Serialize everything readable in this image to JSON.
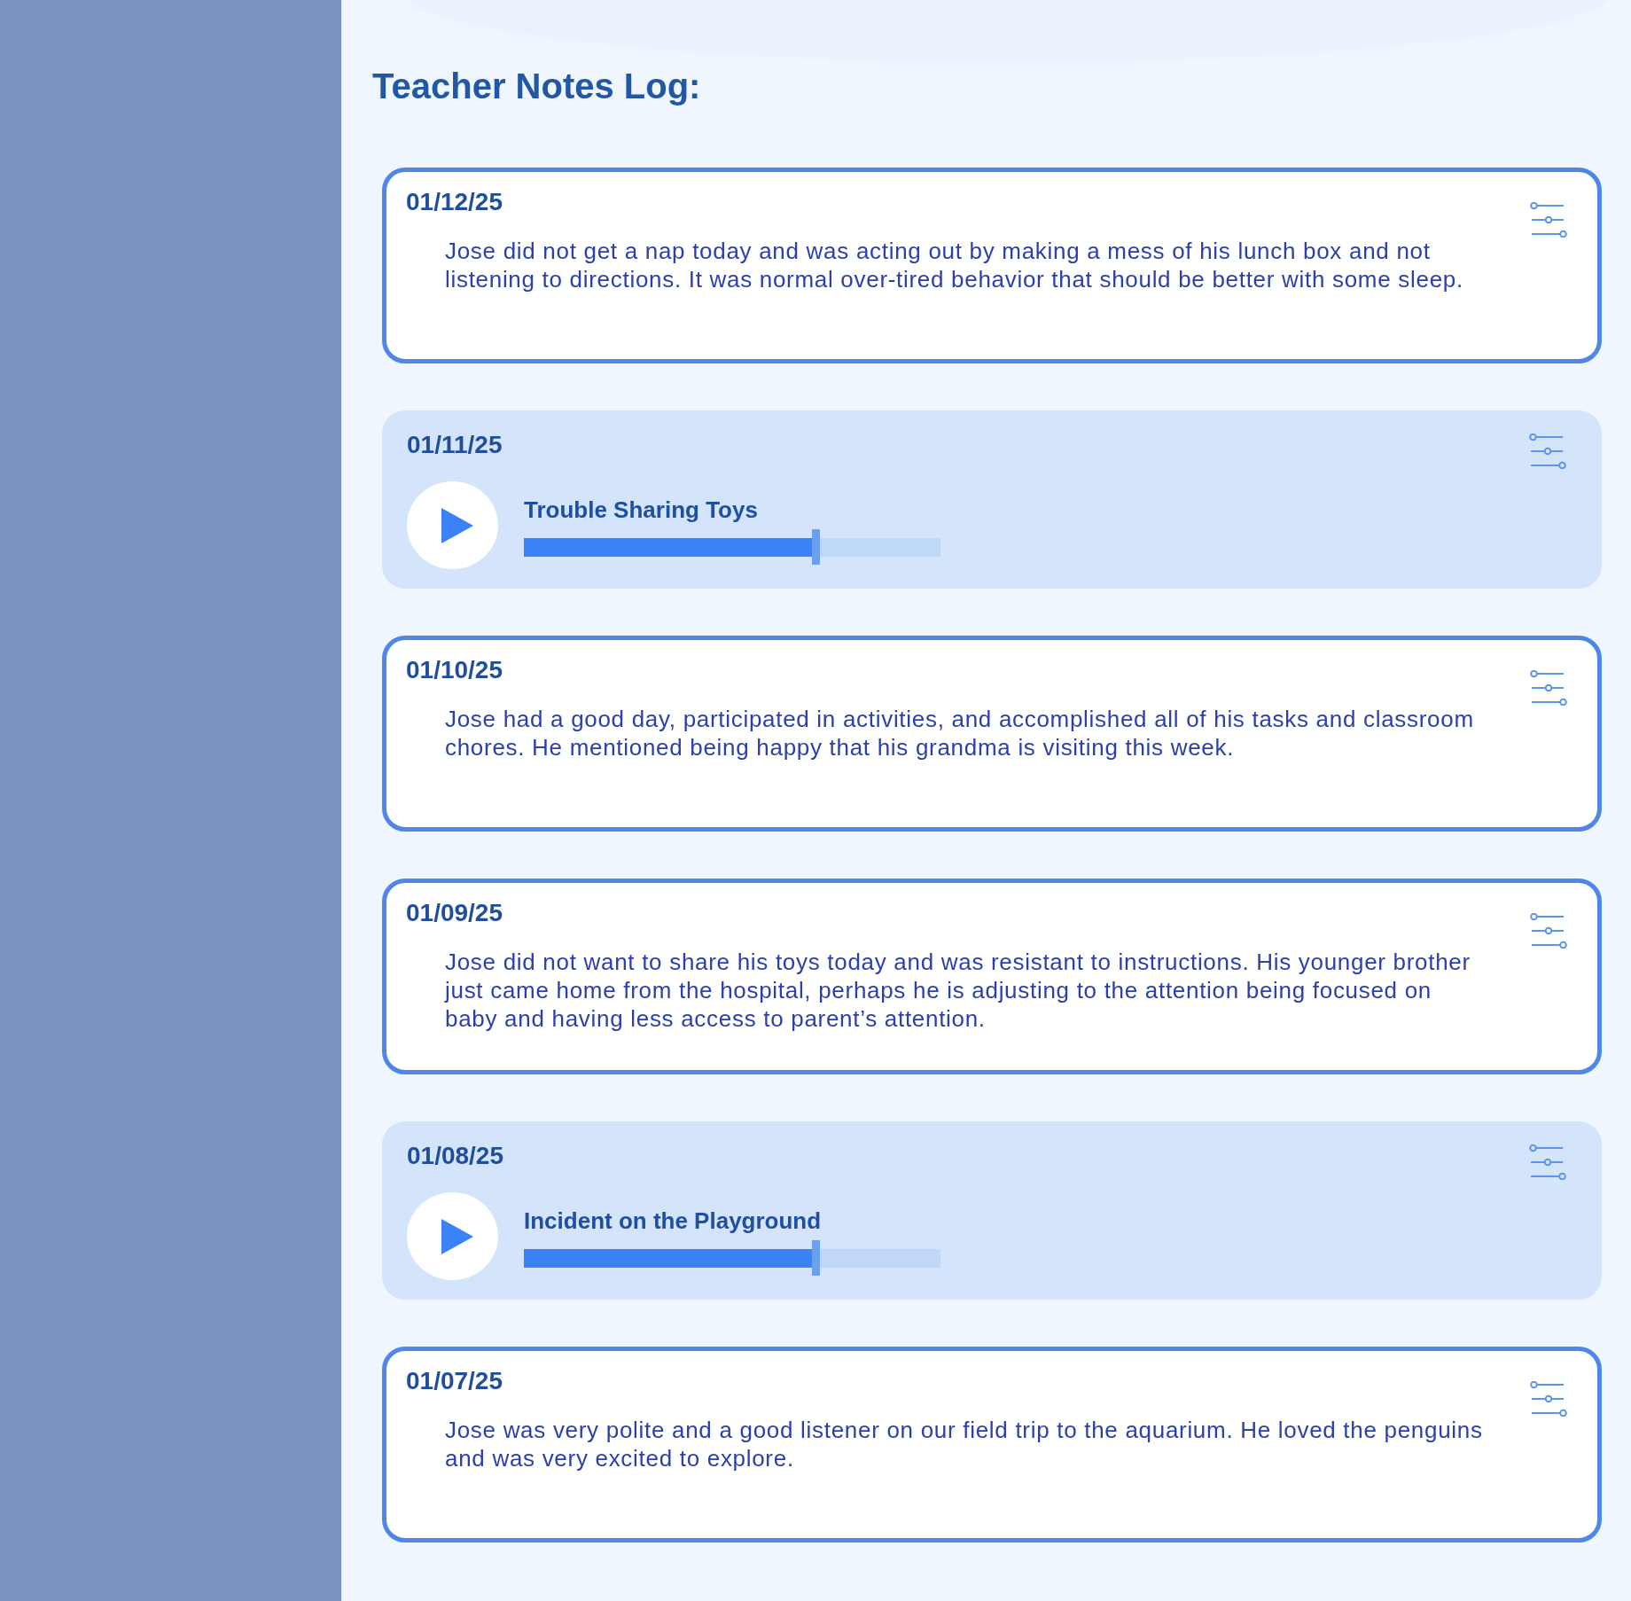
{
  "page_title": "Teacher Notes Log:",
  "notes": [
    {
      "kind": "text",
      "date": "01/12/25",
      "text": "Jose did not get a nap today and was acting out by making a mess of his lunch box and not listening to directions. It was normal over-tired behavior that should be better with some sleep."
    },
    {
      "kind": "audio",
      "date": "01/11/25",
      "title": "Trouble Sharing Toys",
      "level": 0.7
    },
    {
      "kind": "text",
      "date": "01/10/25",
      "text": "Jose had a good day, participated in activities, and accomplished all of his tasks and classroom chores. He mentioned being happy that his grandma is visiting this week."
    },
    {
      "kind": "text",
      "date": "01/09/25",
      "text": "Jose did not want to share his toys today and was resistant to instructions. His younger brother just came home from the hospital, perhaps he is adjusting to the attention being focused on baby and having less access to parent’s attention."
    },
    {
      "kind": "audio",
      "date": "01/08/25",
      "title": "Incident on the Playground",
      "level": 0.7
    },
    {
      "kind": "text",
      "date": "01/07/25",
      "text": "Jose was very polite and a good listener on our field trip to the aquarium. He loved the penguins and was very excited to explore."
    }
  ]
}
